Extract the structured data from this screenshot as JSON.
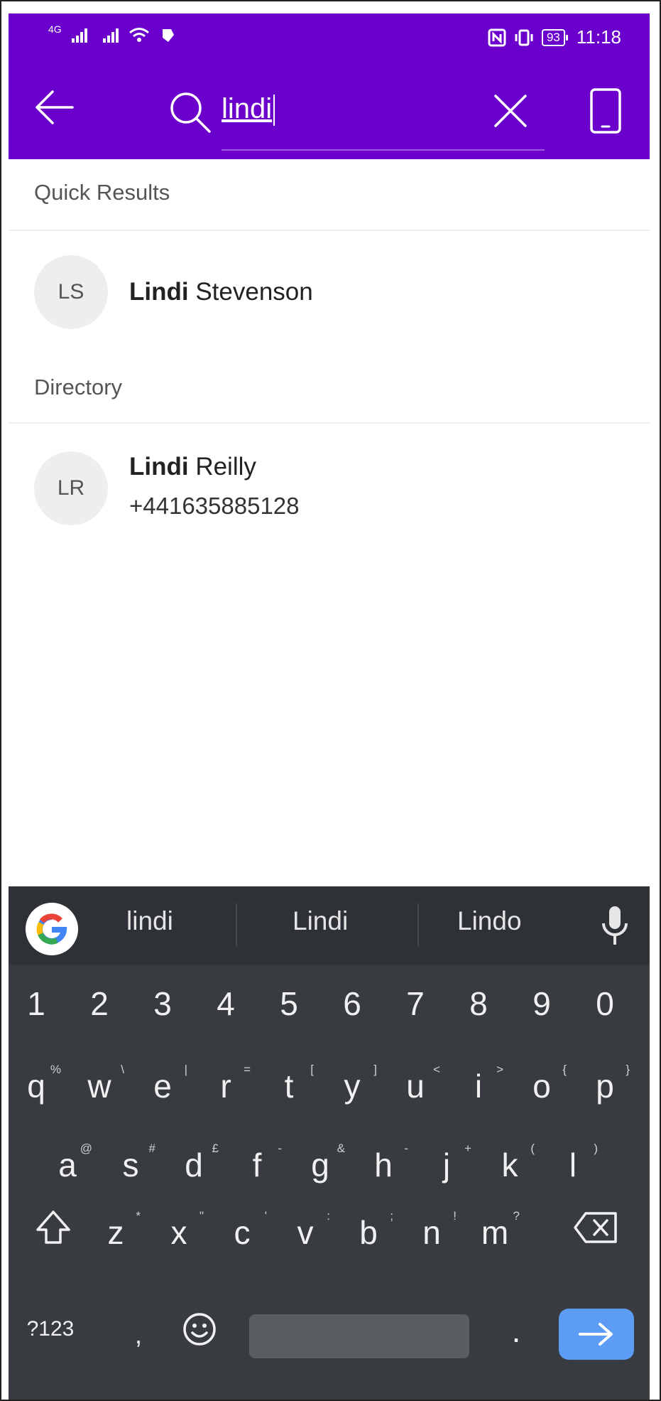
{
  "status_bar": {
    "network": "4G",
    "battery": "93",
    "time": "11:18"
  },
  "search": {
    "query": "lindi"
  },
  "sections": {
    "quick_results": {
      "title": "Quick Results",
      "items": [
        {
          "initials": "LS",
          "match": "Lindi",
          "rest": " Stevenson"
        }
      ]
    },
    "directory": {
      "title": "Directory",
      "items": [
        {
          "initials": "LR",
          "match": "Lindi",
          "rest": " Reilly",
          "phone": "+441635885128"
        }
      ]
    }
  },
  "keyboard": {
    "suggestions": [
      "lindi",
      "Lindi",
      "Lindo"
    ],
    "number_row": [
      "1",
      "2",
      "3",
      "4",
      "5",
      "6",
      "7",
      "8",
      "9",
      "0"
    ],
    "row1": [
      {
        "k": "q",
        "h": "%"
      },
      {
        "k": "w",
        "h": "\\"
      },
      {
        "k": "e",
        "h": "|"
      },
      {
        "k": "r",
        "h": "="
      },
      {
        "k": "t",
        "h": "["
      },
      {
        "k": "y",
        "h": "]"
      },
      {
        "k": "u",
        "h": "<"
      },
      {
        "k": "i",
        "h": ">"
      },
      {
        "k": "o",
        "h": "{"
      },
      {
        "k": "p",
        "h": "}"
      }
    ],
    "row2": [
      {
        "k": "a",
        "h": "@"
      },
      {
        "k": "s",
        "h": "#"
      },
      {
        "k": "d",
        "h": "£"
      },
      {
        "k": "f",
        "h": "-"
      },
      {
        "k": "g",
        "h": "&"
      },
      {
        "k": "h",
        "h": "-"
      },
      {
        "k": "j",
        "h": "+"
      },
      {
        "k": "k",
        "h": "("
      },
      {
        "k": "l",
        "h": ")"
      }
    ],
    "row3": [
      {
        "k": "z",
        "h": "*"
      },
      {
        "k": "x",
        "h": "\""
      },
      {
        "k": "c",
        "h": "'"
      },
      {
        "k": "v",
        "h": ":"
      },
      {
        "k": "b",
        "h": ";"
      },
      {
        "k": "n",
        "h": "!"
      },
      {
        "k": "m",
        "h": "?"
      }
    ],
    "symbols_label": "?123",
    "comma": ",",
    "period": "."
  },
  "colors": {
    "app_bar": "#6b00cc",
    "keyboard_bg": "#383c41",
    "enter_key": "#5d9cf5"
  }
}
